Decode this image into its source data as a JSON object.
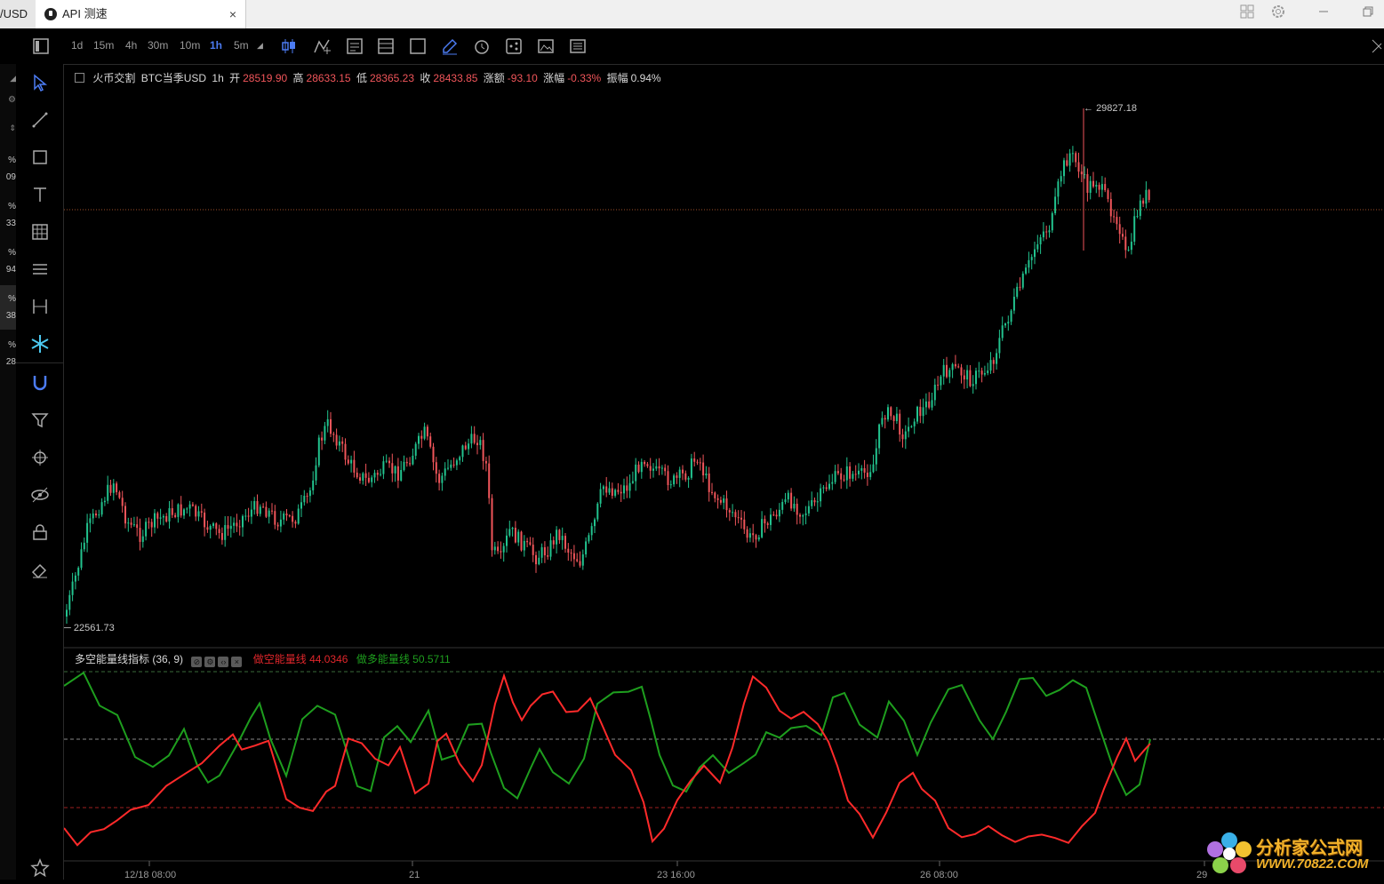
{
  "tabs": [
    {
      "label": "/USD"
    },
    {
      "label": "API 测速",
      "close": "×"
    }
  ],
  "toolbar": {
    "timeframes": [
      "1d",
      "15m",
      "4h",
      "30m",
      "10m",
      "1h",
      "5m"
    ],
    "active_timeframe": "1h"
  },
  "left_edge": {
    "items": [
      {
        "text": "%",
        "color": "#f0555a"
      },
      {
        "text": "09",
        "color": "#888"
      },
      {
        "text": "%",
        "color": "#22c38e"
      },
      {
        "text": "33",
        "color": "#888"
      },
      {
        "text": "%",
        "color": "#f0555a"
      },
      {
        "text": "94",
        "color": "#888"
      },
      {
        "text": "%",
        "color": "#f0555a"
      },
      {
        "text": "38",
        "color": "#888"
      },
      {
        "text": "%",
        "color": "#f0555a"
      },
      {
        "text": "28",
        "color": "#888"
      }
    ]
  },
  "legend": {
    "exchange": "火币交割",
    "symbol": "BTC当季USD",
    "interval": "1h",
    "open_label": "开",
    "open": "28519.90",
    "high_label": "高",
    "high": "28633.15",
    "low_label": "低",
    "low": "28365.23",
    "close_label": "收",
    "close": "28433.85",
    "change_label": "涨额",
    "change": "-93.10",
    "pct_label": "涨幅",
    "pct": "-0.33%",
    "amp_label": "振幅",
    "amp": "0.94%"
  },
  "price_annotations": {
    "max": "29827.18",
    "min": "22561.73"
  },
  "indicator": {
    "name": "多空能量线指标 (36, 9)",
    "short_label": "做空能量线",
    "short_value": "44.0346",
    "long_label": "做多能量线",
    "long_value": "50.5711"
  },
  "colors": {
    "up": "#22c38e",
    "down": "#f0555a",
    "short_line": "#ff2a2a",
    "long_line": "#1e9e1e",
    "accent": "#4c7cf3"
  },
  "chart_data": {
    "type": "line",
    "title": "",
    "x_tick_labels": [
      "12/18 08:00",
      "21",
      "23 16:00",
      "26 08:00",
      "29"
    ],
    "price_range_visible": [
      22561.73,
      29827.18
    ],
    "series": [
      {
        "name": "做多能量线",
        "last": 50.5711
      },
      {
        "name": "做空能量线",
        "last": 44.0346
      }
    ]
  },
  "watermark": {
    "line1": "分析家公式网",
    "line2": "WWW.70822.COM"
  }
}
